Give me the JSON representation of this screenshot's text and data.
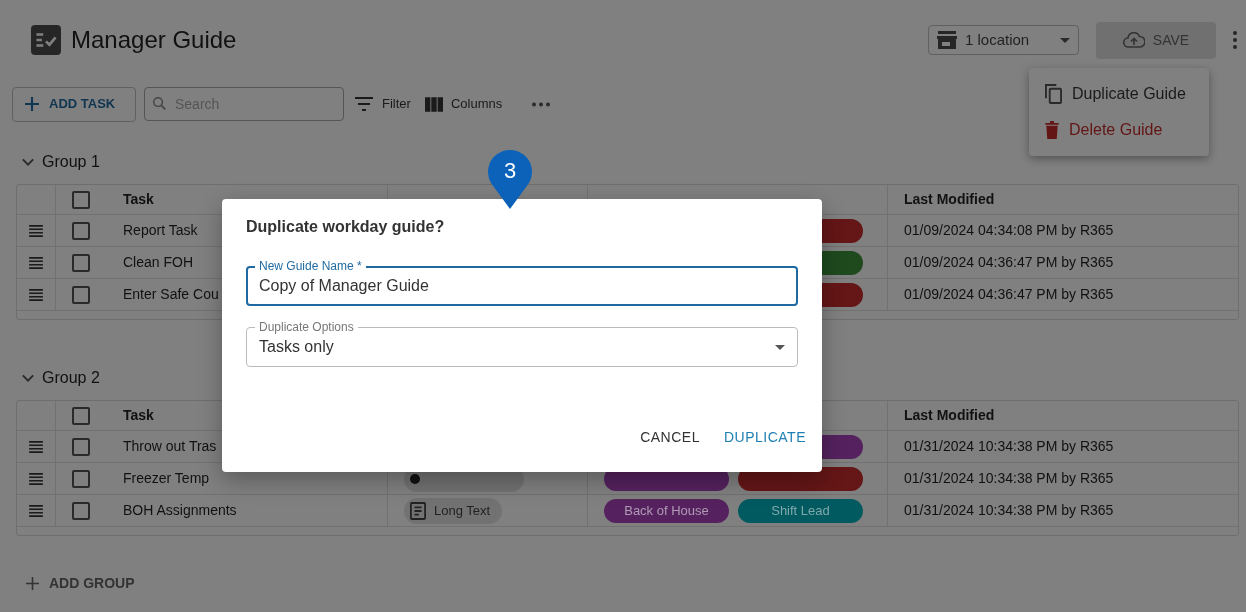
{
  "header": {
    "title": "Manager Guide",
    "location": "1 location",
    "save": {
      "label": "SAVE",
      "disabled": true
    }
  },
  "toolbar": {
    "add_task": "ADD TASK",
    "search_placeholder": "Search",
    "filter": "Filter",
    "columns": "Columns"
  },
  "menu": {
    "open": true,
    "items": [
      {
        "label": "Duplicate Guide",
        "kind": "duplicate"
      },
      {
        "label": "Delete Guide",
        "kind": "delete"
      }
    ]
  },
  "groups": [
    {
      "name": "Group 1",
      "expanded": true,
      "all_checked": false,
      "task_header": "Task",
      "modified_header": "Last Modified",
      "rows": [
        {
          "task": "Report Task",
          "checked": false,
          "tags": [
            {
              "color": "#651616"
            }
          ],
          "modified": "01/09/2024 04:34:08 PM by R365"
        },
        {
          "task": "Clean FOH",
          "checked": false,
          "tags": [
            {
              "color": "#1e4a1e"
            }
          ],
          "modified": "01/09/2024 04:36:47 PM by R365"
        },
        {
          "task": "Enter Safe Cou",
          "checked": false,
          "tags": [
            {
              "color": "#651616"
            }
          ],
          "modified": "01/09/2024 04:36:47 PM by R365"
        }
      ]
    },
    {
      "name": "Group 2",
      "expanded": true,
      "all_checked": false,
      "task_header": "Task",
      "modified_header": "Last Modified",
      "rows": [
        {
          "task": "Throw out Tras",
          "checked": false,
          "tags": [
            {
              "color": "#55225f"
            }
          ],
          "modified": "01/31/2024 10:34:38 PM by R365"
        },
        {
          "task": "Freezer Temp",
          "checked": false,
          "type": {
            "kind": "temperature"
          },
          "tags": [
            {
              "color": "#55225f"
            },
            {
              "color": "#651616"
            }
          ],
          "modified": "01/31/2024 10:34:38 PM by R365"
        },
        {
          "task": "BOH Assignments",
          "checked": false,
          "type": {
            "kind": "long_text",
            "label": "Long Text"
          },
          "tags": [
            {
              "color": "#55225f",
              "label": "Back of House"
            },
            {
              "color": "#005a60",
              "label": "Shift Lead"
            }
          ],
          "modified": "01/31/2024 10:34:38 PM by R365"
        }
      ]
    }
  ],
  "add_group": "ADD GROUP",
  "dialog": {
    "title": "Duplicate workday guide?",
    "name_field": {
      "label": "New Guide Name *",
      "value": "Copy of Manager Guide",
      "focused": true
    },
    "options_field": {
      "label": "Duplicate Options",
      "value": "Tasks only"
    },
    "buttons": [
      {
        "label": "CANCEL",
        "kind": "secondary"
      },
      {
        "label": "DUPLICATE",
        "kind": "primary"
      }
    ]
  },
  "step_marker": "3"
}
